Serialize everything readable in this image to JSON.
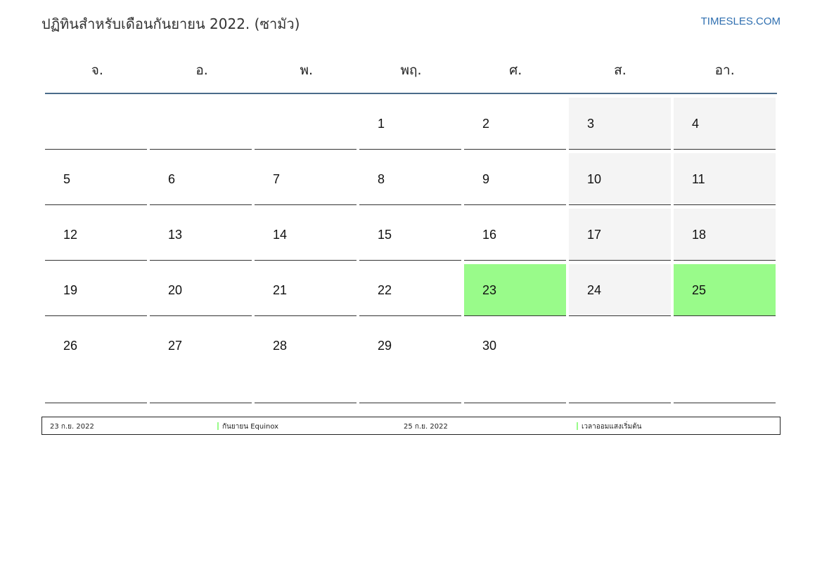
{
  "header": {
    "title": "ปฏิทินสำหรับเดือนกันยายน 2022. (ซามัว)",
    "site": "TIMESLES.COM"
  },
  "calendar": {
    "weekdays": [
      "จ.",
      "อ.",
      "พ.",
      "พฤ.",
      "ศ.",
      "ส.",
      "อา."
    ],
    "weeks": [
      [
        "",
        "",
        "",
        "1",
        "2",
        "3",
        "4"
      ],
      [
        "5",
        "6",
        "7",
        "8",
        "9",
        "10",
        "11"
      ],
      [
        "12",
        "13",
        "14",
        "15",
        "16",
        "17",
        "18"
      ],
      [
        "19",
        "20",
        "21",
        "22",
        "23",
        "24",
        "25"
      ],
      [
        "26",
        "27",
        "28",
        "29",
        "30",
        "",
        ""
      ]
    ],
    "highlighted_days": [
      "23",
      "25"
    ],
    "colors": {
      "event": "#99fb8a",
      "weekend": "#f4f4f4",
      "header_rule": "#4a6b8a",
      "link": "#2f6fb0"
    }
  },
  "legend": [
    {
      "date": "23 ก.ย. 2022",
      "label": "กันยายน Equinox"
    },
    {
      "date": "25 ก.ย. 2022",
      "label": "เวลาออมแสงเริ่มต้น"
    }
  ]
}
